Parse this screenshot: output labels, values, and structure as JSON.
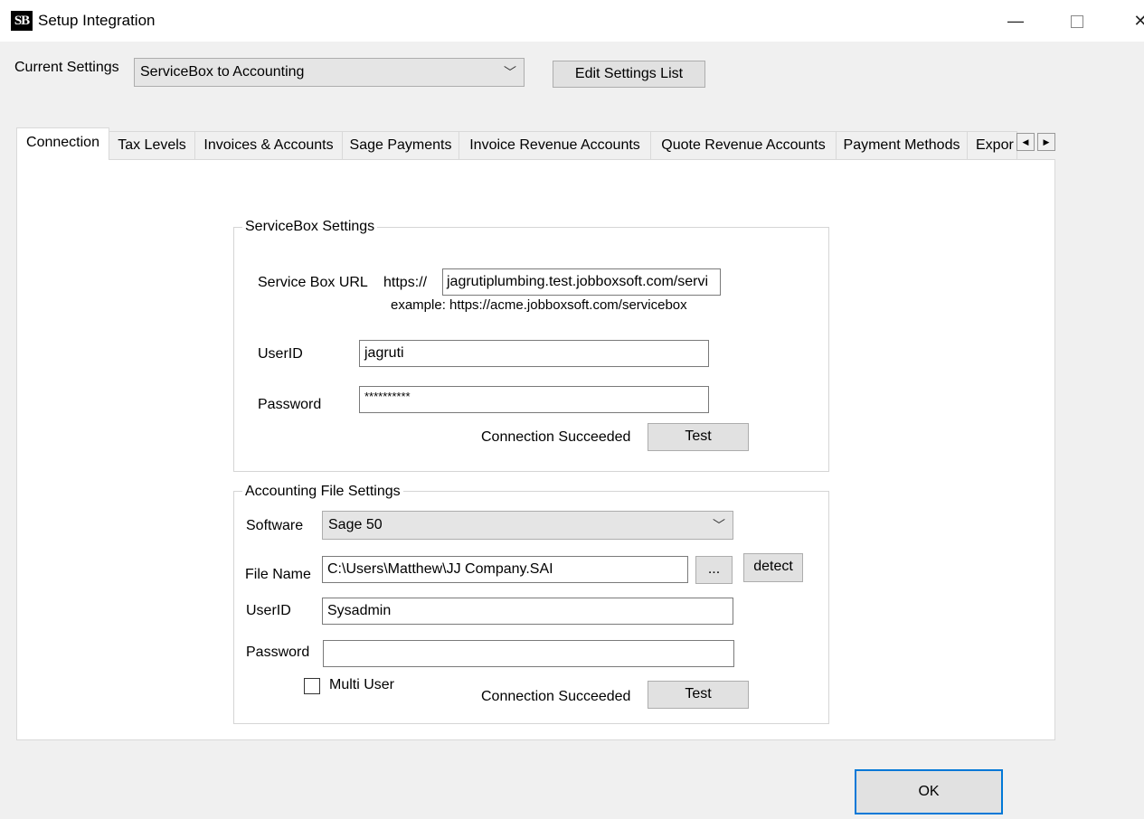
{
  "window": {
    "icon_text": "SB",
    "title": "Setup Integration",
    "minimize_glyph": "—",
    "close_glyph": "✕"
  },
  "current_settings": {
    "label": "Current Settings",
    "selected": "ServiceBox to Accounting",
    "edit_button": "Edit Settings List"
  },
  "tabs": [
    {
      "label": "Connection",
      "active": true
    },
    {
      "label": "Tax Levels"
    },
    {
      "label": "Invoices & Accounts"
    },
    {
      "label": "Sage Payments"
    },
    {
      "label": "Invoice Revenue Accounts"
    },
    {
      "label": "Quote Revenue Accounts"
    },
    {
      "label": "Payment Methods"
    },
    {
      "label": "Expor"
    }
  ],
  "tab_scroll": {
    "left": "◀",
    "right": "▶"
  },
  "servicebox": {
    "legend": "ServiceBox Settings",
    "url_label": "Service Box URL",
    "url_prefix": "https://",
    "url_value": "jagrutiplumbing.test.jobboxsoft.com/servi",
    "example": "example: https://acme.jobboxsoft.com/servicebox",
    "userid_label": "UserID",
    "userid_value": "jagruti",
    "password_label": "Password",
    "password_value": "**********",
    "status": "Connection Succeeded",
    "test_button": "Test"
  },
  "accounting": {
    "legend": "Accounting File Settings",
    "software_label": "Software",
    "software_value": "Sage 50",
    "filename_label": "File Name",
    "filename_value": "C:\\Users\\Matthew\\JJ Company.SAI",
    "browse_button": "...",
    "detect_button": "detect",
    "userid_label": "UserID",
    "userid_value": "Sysadmin",
    "password_label": "Password",
    "password_value": "",
    "multi_user_label": "Multi User",
    "multi_user_checked": false,
    "status": "Connection Succeeded",
    "test_button": "Test"
  },
  "ok_button": "OK",
  "colors": {
    "focus_border": "#0078d7",
    "panel_bg": "#ffffff",
    "window_bg": "#f0f0f0"
  }
}
